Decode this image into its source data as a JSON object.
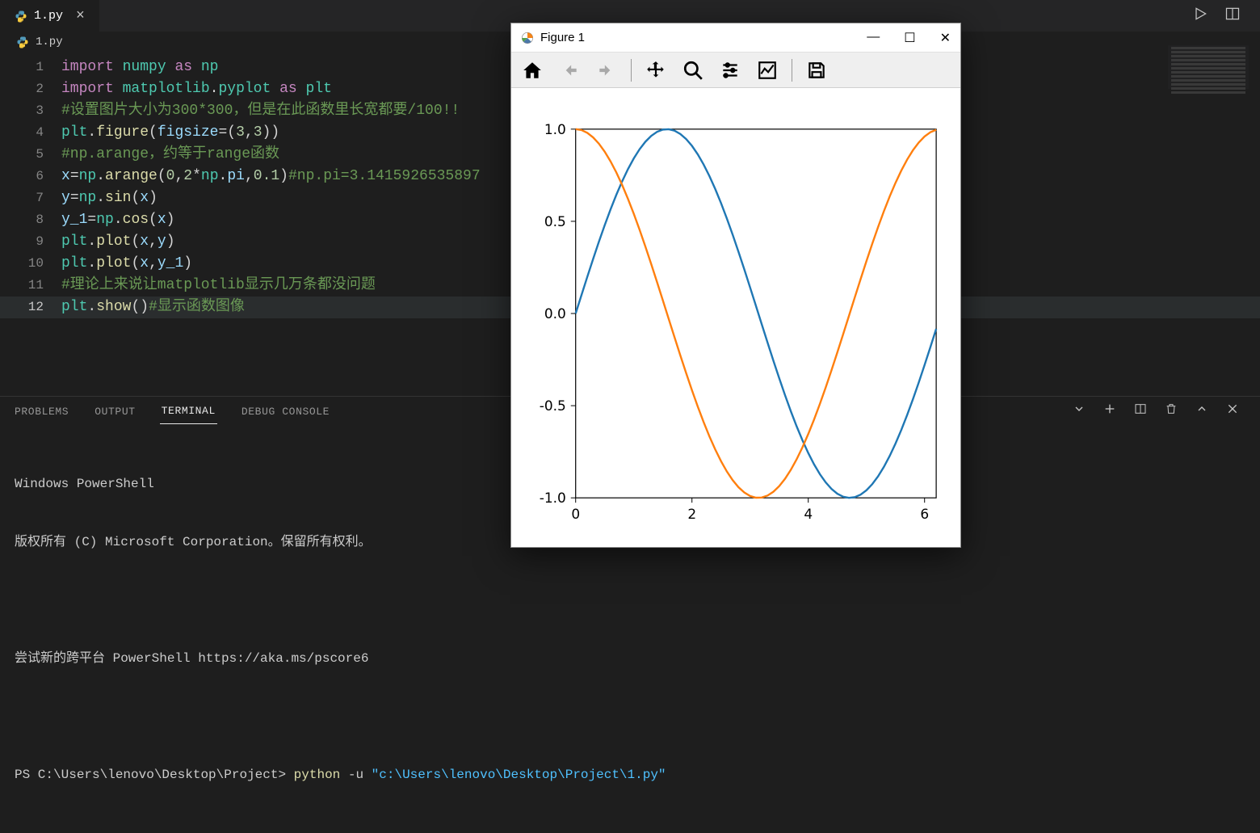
{
  "tab": {
    "filename": "1.py",
    "close_glyph": "×"
  },
  "breadcrumb": {
    "filename": "1.py"
  },
  "title_actions": {
    "run_icon": "▷",
    "split_icon": "▥"
  },
  "code_lines": [
    "import numpy as np",
    "import matplotlib.pyplot as plt",
    "#设置图片大小为300*300，但是在此函数里长宽都要/100!!",
    "plt.figure(figsize=(3,3))",
    "#np.arange，约等于range函数",
    "x=np.arange(0,2*np.pi,0.1)#np.pi=3.1415926535897",
    "y=np.sin(x)",
    "y_1=np.cos(x)",
    "plt.plot(x,y)",
    "plt.plot(x,y_1)",
    "#理论上来说让matplotlib显示几万条都没问题",
    "plt.show()#显示函数图像"
  ],
  "panel": {
    "tabs": {
      "problems": "PROBLEMS",
      "output": "OUTPUT",
      "terminal": "TERMINAL",
      "debug": "DEBUG CONSOLE"
    }
  },
  "terminal": {
    "line1": "Windows PowerShell",
    "line2": "版权所有 (C) Microsoft Corporation。保留所有权利。",
    "line3": "尝试新的跨平台 PowerShell https://aka.ms/pscore6",
    "prompt": "PS C:\\Users\\lenovo\\Desktop\\Project> ",
    "cmd_py": "python",
    "cmd_flag": " -u ",
    "cmd_path": "\"c:\\Users\\lenovo\\Desktop\\Project\\1.py\""
  },
  "figure": {
    "title": "Figure 1",
    "win": {
      "min": "—",
      "max": "☐",
      "close": "✕"
    }
  },
  "chart_data": {
    "type": "line",
    "x_start": 0,
    "x_end": 6.2,
    "x_step": 0.1,
    "series": [
      {
        "name": "sin(x)",
        "fn": "sin",
        "color": "#1f77b4"
      },
      {
        "name": "cos(x)",
        "fn": "cos",
        "color": "#ff7f0e"
      }
    ],
    "xlim": [
      0,
      6.2
    ],
    "ylim": [
      -1.0,
      1.0
    ],
    "xticks": [
      0,
      2,
      4,
      6
    ],
    "yticks": [
      -1.0,
      -0.5,
      0.0,
      0.5,
      1.0
    ]
  }
}
